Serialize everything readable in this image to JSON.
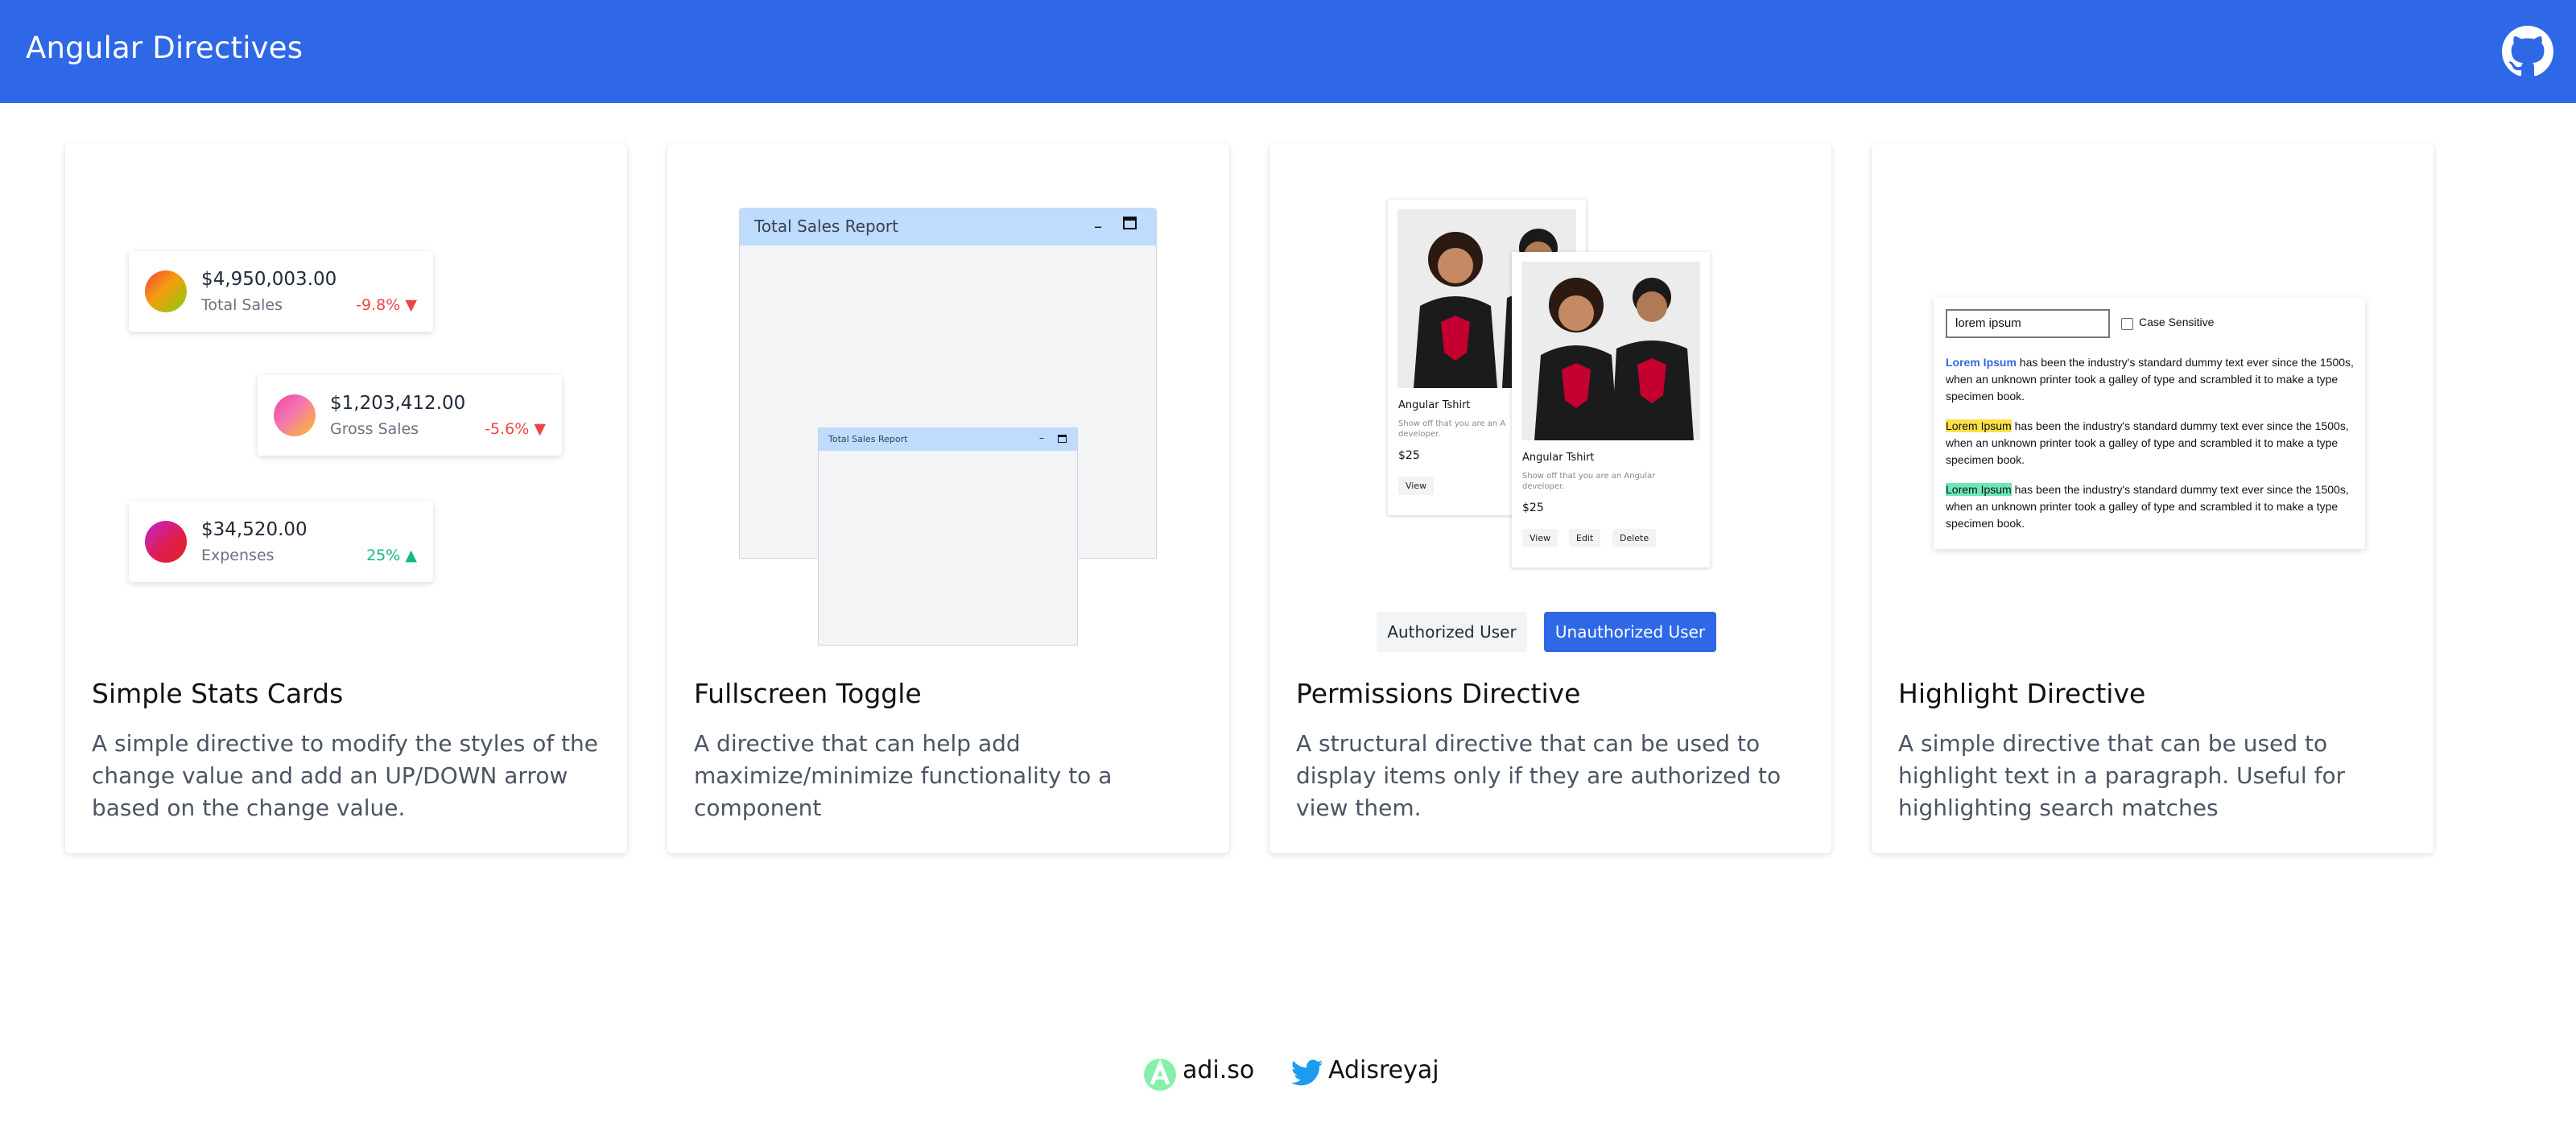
{
  "header": {
    "title": "Angular Directives",
    "github_icon": "github-icon",
    "background": "#2f68e6"
  },
  "cards": [
    {
      "title": "Simple Stats Cards",
      "description": "A simple directive to modify the styles of the change value and add an UP/DOWN arrow based on the change value.",
      "stats": [
        {
          "amount": "$4,950,003.00",
          "label": "Total Sales",
          "change": "-9.8%",
          "direction": "down"
        },
        {
          "amount": "$1,203,412.00",
          "label": "Gross Sales",
          "change": "-5.6%",
          "direction": "down"
        },
        {
          "amount": "$34,520.00",
          "label": "Expenses",
          "change": "25%",
          "direction": "up"
        }
      ]
    },
    {
      "title": "Fullscreen Toggle",
      "description": "A directive that can help add maximize/minimize functionality to a component",
      "window_title": "Total Sales Report",
      "small_window_title": "Total Sales Report"
    },
    {
      "title": "Permissions Directive",
      "description": "A structural directive that can be used to display items only if they are authorized to view them.",
      "product_back": {
        "name": "Angular Tshirt",
        "desc": "Show off that you are an A developer.",
        "price": "$25",
        "btn_view": "View"
      },
      "product_front": {
        "name": "Angular Tshirt",
        "desc": "Show off that you are an Angular developer.",
        "price": "$25",
        "btn_view": "View",
        "btn_edit": "Edit",
        "btn_delete": "Delete"
      },
      "toggle_authorized": "Authorized User",
      "toggle_unauthorized": "Unauthorized User",
      "selected_toggle": "Unauthorized User"
    },
    {
      "title": "Highlight Directive",
      "description": "A simple directive that can be used to highlight text in a paragraph. Useful for highlighting search matches",
      "search_value": "lorem ipsum",
      "checkbox_label": "Case Sensitive",
      "match": "Lorem Ipsum",
      "paragraph_rest": " has been the industry's standard dummy text ever since the 1500s, when an unknown printer took a galley of type and scrambled it to make a type specimen book."
    }
  ],
  "footer": {
    "site": "adi.so",
    "twitter": "Adisreyaj"
  }
}
